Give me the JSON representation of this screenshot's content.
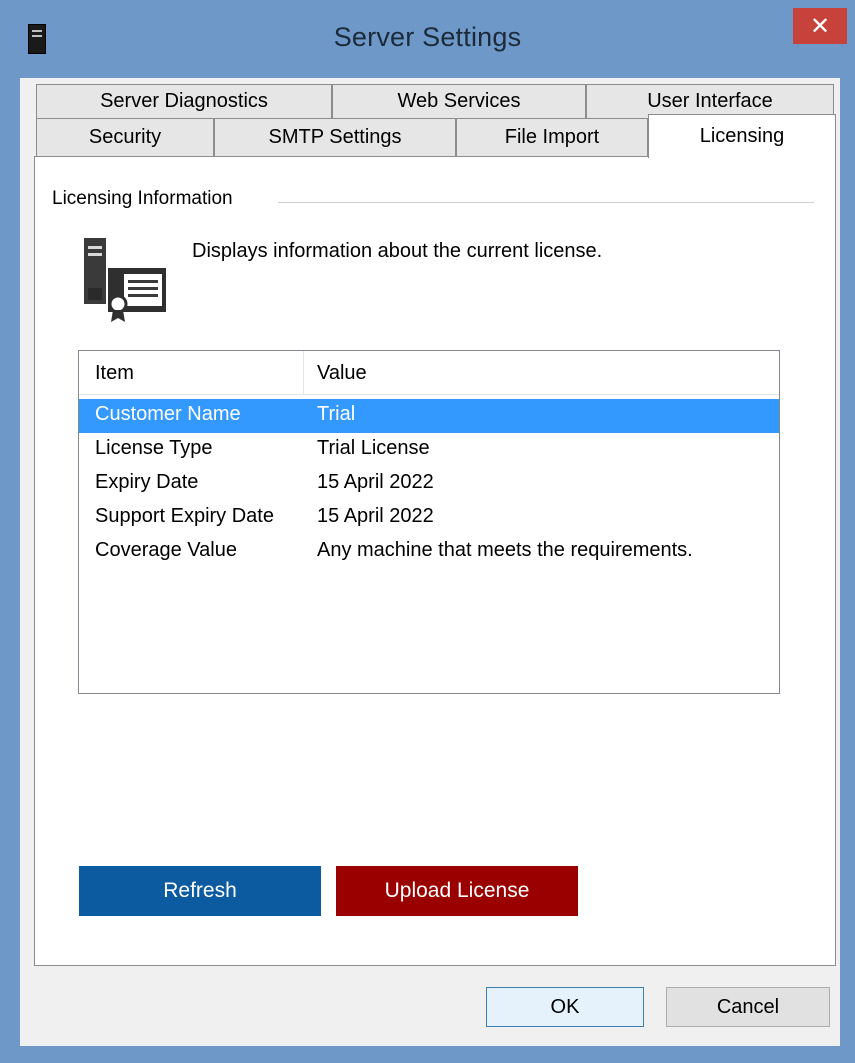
{
  "window": {
    "title": "Server Settings",
    "close_glyph": "✕"
  },
  "tabs": {
    "row1": [
      "Server Diagnostics",
      "Web Services",
      "User Interface"
    ],
    "row2": [
      "Security",
      "SMTP Settings",
      "File Import",
      "Licensing"
    ],
    "active": "Licensing"
  },
  "licensing": {
    "group_label": "Licensing Information",
    "description": "Displays information about the current license.",
    "icon": "license-certificate-icon"
  },
  "table": {
    "columns": [
      "Item",
      "Value"
    ],
    "rows": [
      {
        "item": "Customer Name",
        "value": "Trial",
        "selected": true
      },
      {
        "item": "License Type",
        "value": "Trial License",
        "selected": false
      },
      {
        "item": "Expiry Date",
        "value": "15 April 2022",
        "selected": false
      },
      {
        "item": "Support Expiry Date",
        "value": "15 April 2022",
        "selected": false
      },
      {
        "item": "Coverage Value",
        "value": "Any machine that meets the requirements.",
        "selected": false
      }
    ]
  },
  "buttons": {
    "refresh": "Refresh",
    "upload": "Upload License",
    "ok": "OK",
    "cancel": "Cancel"
  },
  "colors": {
    "titlebar": "#6d98c8",
    "close": "#c7423a",
    "refresh": "#0c5aa0",
    "upload": "#9b0000",
    "selection": "#3399ff"
  }
}
